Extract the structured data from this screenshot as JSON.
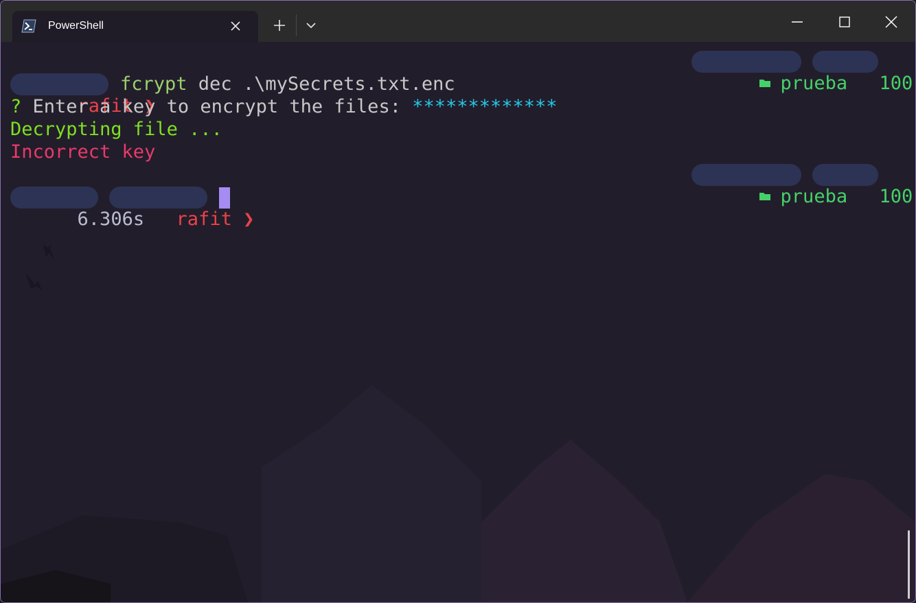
{
  "window": {
    "tab_title": "PowerShell"
  },
  "prompt_right": {
    "folder": "prueba",
    "battery": "100"
  },
  "lines": {
    "prompt_user": "rafit ❯",
    "command_name": "fcrypt",
    "command_args": " dec .\\mySecrets.txt.enc",
    "question_mark": "?",
    "question_text": " Enter a key to encrypt the files: ",
    "masked_key": "*************",
    "decrypting": "Decrypting file ...",
    "error": "Incorrect key",
    "duration": "6.306s",
    "prompt_user_2": "rafit ❯"
  },
  "colors": {
    "accent_border": "#8a6fb3",
    "prompt_pill_bg": "#2d3354",
    "user": "#e9434a",
    "folder": "#45d168",
    "command": "#9bd16c",
    "masked": "#25c8e6",
    "success": "#7ee020",
    "error": "#e83a69",
    "cursor": "#a58cf2"
  },
  "icons": {
    "tab": "powershell-icon",
    "close_tab": "close-icon",
    "new_tab": "plus-icon",
    "dropdown": "chevron-down-icon",
    "folder": "folder-icon"
  }
}
